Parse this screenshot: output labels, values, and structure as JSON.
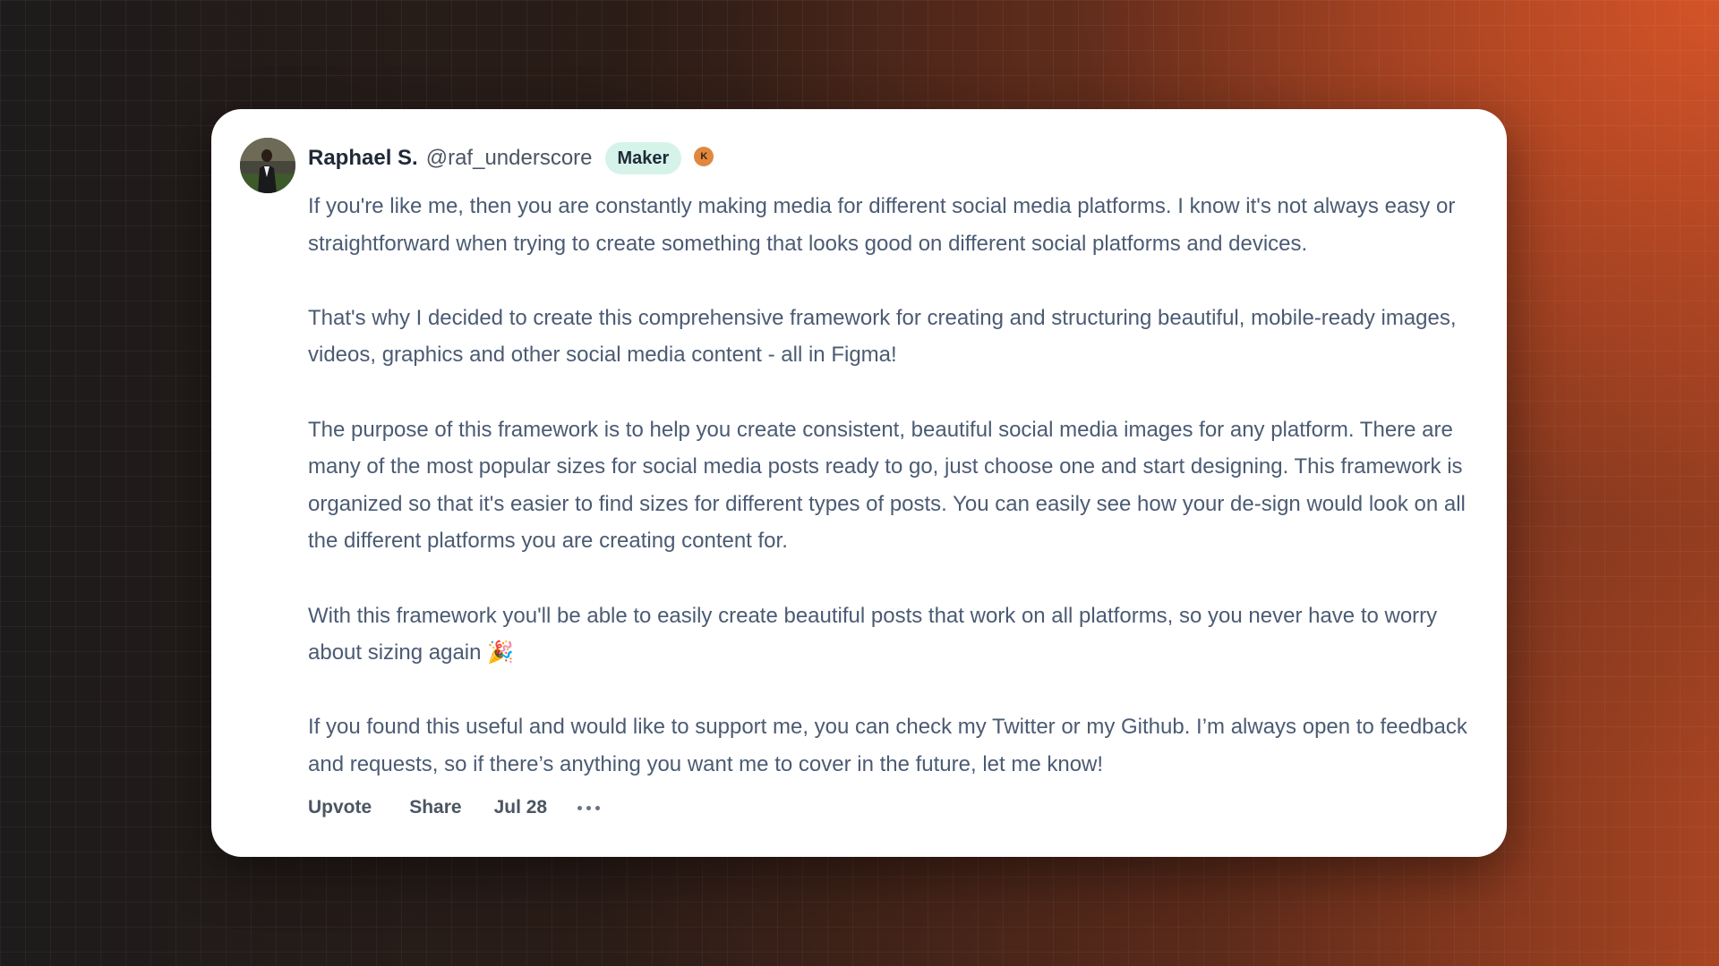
{
  "post": {
    "author": {
      "name": "Raphael S.",
      "handle": "@raf_underscore",
      "badge": "Maker",
      "karma_badge": "K"
    },
    "paragraphs": [
      "If you're like me, then you are constantly making media for different social media platforms. I know it's not always easy or straightforward when trying to create something that looks good on different social platforms and devices.",
      "That's why I decided to create this comprehensive framework for creating and structuring beautiful, mobile-ready images, videos, graphics and other social media content - all in Figma!",
      "The purpose of this framework is to help you create consistent, beautiful social media images for any platform. There are many of the most popular sizes for social media posts ready to go, just choose one and start designing. This framework is organized so that it's easier to find sizes for different types of posts. You can easily see how your de-sign would look on all the different platforms you are creating content for.",
      "With this framework you'll be able to easily create beautiful posts that work on all platforms, so you never have to worry about sizing again 🎉",
      "If you found this useful and would like to support me, you can check my Twitter or my Github. I’m always open to feedback and requests, so if there’s anything you want me to cover in the future, let me know!"
    ],
    "actions": {
      "upvote": "Upvote",
      "share": "Share",
      "date": "Jul 28",
      "more_icon": "more-horizontal-icon"
    }
  },
  "colors": {
    "badge_bg": "#d6f3ea",
    "karma": "#e0883f",
    "text_body": "#4b5b73"
  }
}
